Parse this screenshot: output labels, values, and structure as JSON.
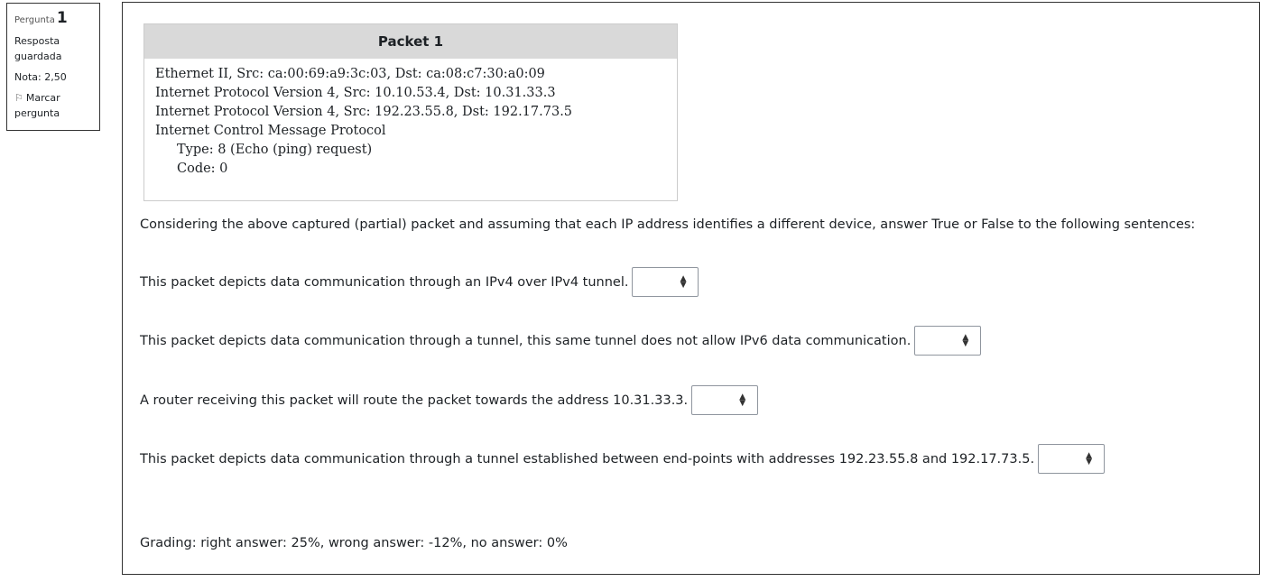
{
  "question_info": {
    "number_label": "Pergunta",
    "number": "1",
    "state": "Resposta guardada",
    "grade": "Nota: 2,50",
    "flag_label": "Marcar pergunta"
  },
  "packet": {
    "title": "Packet 1",
    "lines": [
      "Ethernet II, Src: ca:00:69:a9:3c:03, Dst: ca:08:c7:30:a0:09",
      "Internet Protocol Version 4, Src: 10.10.53.4, Dst: 10.31.33.3",
      "Internet Protocol Version 4, Src: 192.23.55.8, Dst: 192.17.73.5",
      "Internet Control Message Protocol",
      "Type: 8 (Echo (ping) request)",
      "Code: 0"
    ]
  },
  "intro": "Considering the above captured (partial) packet and assuming that each IP address identifies a different device, answer True or False to the following sentences:",
  "sentences": [
    {
      "text": "This packet depicts data communication through an IPv4 over IPv4 tunnel.",
      "selected": ""
    },
    {
      "text": "This packet depicts data communication through a tunnel, this same tunnel does not allow IPv6 data communication.",
      "selected": ""
    },
    {
      "text": "A router receiving this packet will route the packet towards the address 10.31.33.3.",
      "selected": ""
    },
    {
      "text": "This packet depicts data communication through a tunnel established between end-points with addresses 192.23.55.8 and 192.17.73.5.",
      "selected": ""
    }
  ],
  "grading": "Grading: right answer: 25%, wrong answer: -12%, no answer: 0%",
  "icons": {
    "flag": "flag-icon",
    "select_arrows": "sort-arrows-icon"
  }
}
